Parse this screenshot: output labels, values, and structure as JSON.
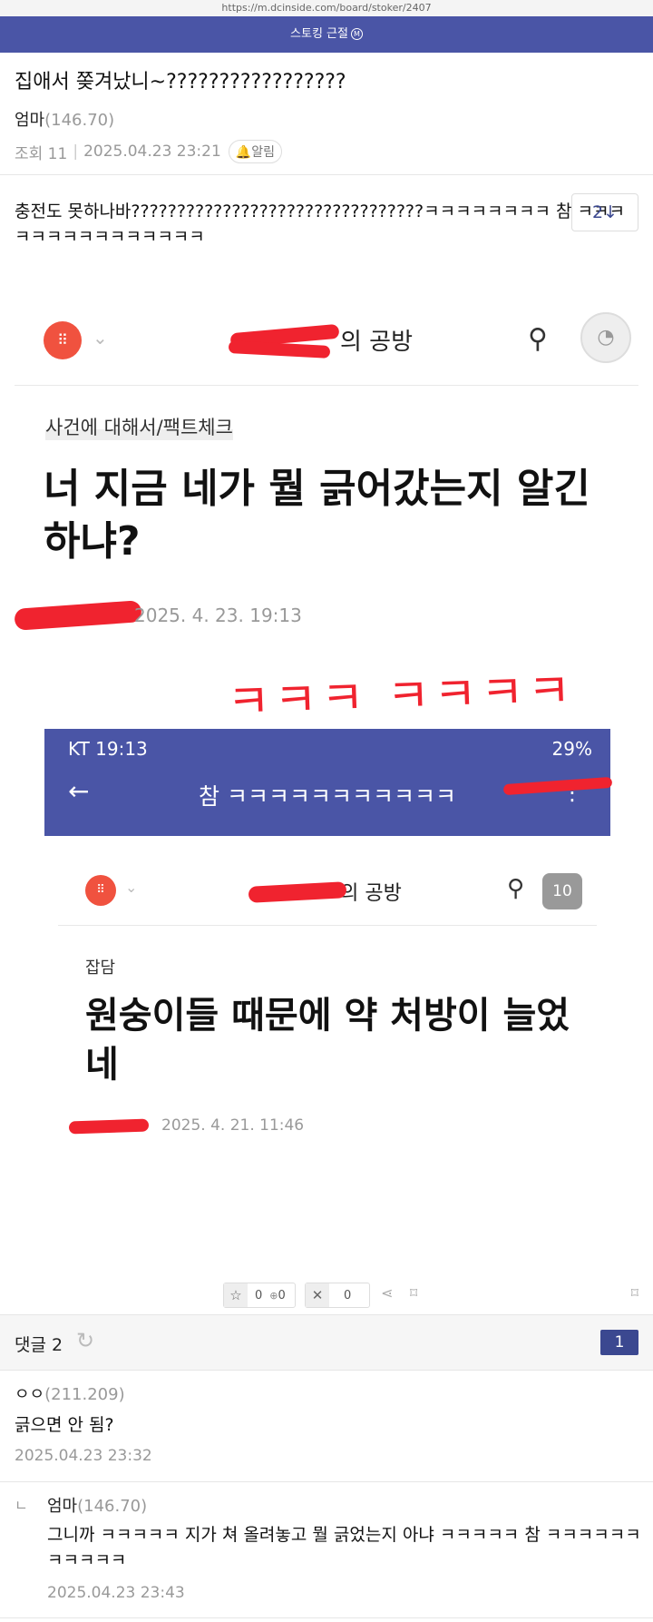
{
  "url": "https://m.dcinside.com/board/stoker/2407",
  "gallery": {
    "name": "스토킹 근절",
    "badge": "M"
  },
  "post": {
    "title": "집애서 쫒겨났니~?????????????????",
    "author_name": "엄마",
    "author_ip": "(146.70)",
    "views_label": "조회 11",
    "date": "2025.04.23 23:21",
    "alarm_label": "알림",
    "comment_jump": "2↓",
    "body": "충전도 못하나바????????????????????????????????ㅋㅋㅋㅋㅋㅋㅋㅋ 참 ㅋㅋㅋㅋㅋㅋㅋㅋㅋㅋㅋㅋㅋㅋㅋ"
  },
  "embedded": {
    "blog_name_suffix": "의 공방",
    "category": "사건에 대해서/팩트체크",
    "title": "너 지금 네가 뭘 긁어갔는지 알긴 하냐?",
    "date": "2025. 4. 23. 19:13",
    "scribble": "ㅋㅋㅋ ㅋㅋㅋㅋ",
    "phone_status_left": "KT 19:13",
    "phone_status_right": "29%",
    "phone_title": "참 ㅋㅋㅋㅋㅋㅋㅋㅋㅋㅋㅋ",
    "blog_name2_suffix": "의 공방",
    "notif_count": "10",
    "category2": "잡담",
    "title2": "원숭이들 때문에 약 처방이 늘었네",
    "date2": "2025. 4. 21. 11:46"
  },
  "actions": {
    "recommend_count": "0",
    "recommend_fix_count": "0",
    "dislike_count": "0"
  },
  "comments_header": {
    "label": "댓글 2",
    "page": "1"
  },
  "comments": [
    {
      "author": "ㅇㅇ",
      "ip": "(211.209)",
      "text": "긁으면 안 됨?",
      "date": "2025.04.23 23:32"
    },
    {
      "author": "엄마",
      "ip": "(146.70)",
      "text": "그니까 ㅋㅋㅋㅋㅋ 지가 쳐 올려놓고 뭘 긁었는지 아냐 ㅋㅋㅋㅋㅋ 참 ㅋㅋㅋㅋㅋㅋㅋㅋㅋㅋㅋ",
      "date": "2025.04.23 23:43",
      "reply_mark": "ㄴ"
    }
  ],
  "colors": {
    "brand": "#4a55a6",
    "accent": "#3b4890",
    "redmark": "#f0232f",
    "blog_orange": "#f0523f"
  },
  "icons": {
    "alarm": "bell-icon",
    "refresh": "refresh-icon",
    "star": "star-icon",
    "dislike": "x-icon",
    "share": "share-icon",
    "bookmark": "bookmark-icon"
  }
}
